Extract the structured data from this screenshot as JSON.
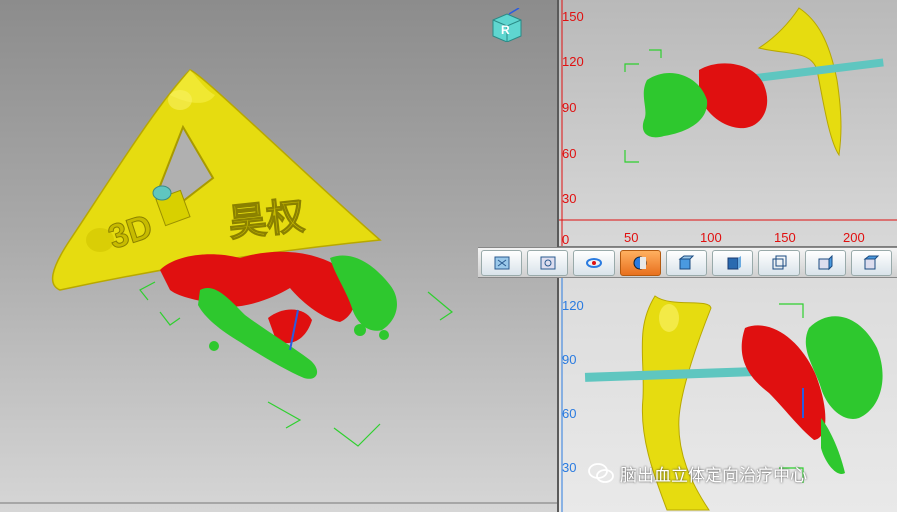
{
  "main_view": {
    "plate_text_left": "3D",
    "plate_text_right": "昊权"
  },
  "orientation_cube": {
    "face_letter": "R"
  },
  "top_right_view": {
    "y_ticks": [
      "150",
      "120",
      "90",
      "60",
      "30",
      "0"
    ],
    "x_ticks": [
      "50",
      "100",
      "150",
      "200"
    ]
  },
  "bottom_right_view": {
    "y_ticks": [
      "120",
      "90",
      "60",
      "30"
    ]
  },
  "toolbar": {
    "buttons": [
      {
        "icon": "fit-view-icon"
      },
      {
        "icon": "zoom-window-icon"
      },
      {
        "icon": "rotate-icon"
      },
      {
        "icon": "shaded-view-icon",
        "active": true
      },
      {
        "icon": "cube-front-icon"
      },
      {
        "icon": "cube-back-icon"
      },
      {
        "icon": "cube-wireframe-icon"
      },
      {
        "icon": "cube-side-icon"
      },
      {
        "icon": "cube-top-icon"
      }
    ]
  },
  "watermark": {
    "text": "脑出血立体定向治疗中心"
  },
  "colors": {
    "plate": "#e6dc10",
    "hematoma": "#e01010",
    "tissue": "#2ec82e",
    "needle": "#5fc6c0",
    "red_axis": "#e01010",
    "blue_axis": "#2a7be0"
  }
}
